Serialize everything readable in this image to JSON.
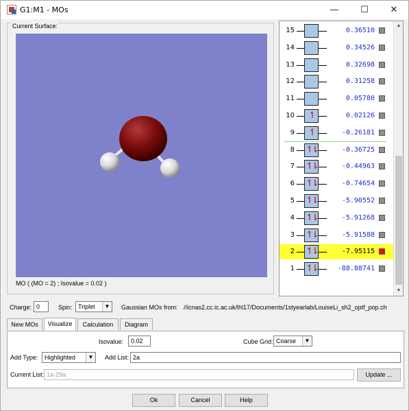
{
  "window": {
    "title": "G1:M1 - MOs"
  },
  "surface": {
    "legend": "Current Surface:",
    "caption": "MO ( (MO = 2) ; Isovalue = 0.02 )"
  },
  "mo_list": [
    {
      "n": "15",
      "energy": "0.36510",
      "occ": "",
      "selected": false,
      "checked": false
    },
    {
      "n": "14",
      "energy": "0.34526",
      "occ": "",
      "selected": false,
      "checked": false
    },
    {
      "n": "13",
      "energy": "0.32698",
      "occ": "",
      "selected": false,
      "checked": false
    },
    {
      "n": "12",
      "energy": "0.31258",
      "occ": "",
      "selected": false,
      "checked": false
    },
    {
      "n": "11",
      "energy": "0.05780",
      "occ": "",
      "selected": false,
      "checked": false
    },
    {
      "n": "10",
      "energy": "0.02126",
      "occ": "↿",
      "selected": false,
      "checked": false
    },
    {
      "n": "9",
      "energy": "-0.26181",
      "occ": "↿",
      "selected": false,
      "checked": false
    },
    {
      "n": "8",
      "energy": "-0.36725",
      "occ": "↿⇂",
      "selected": false,
      "checked": false
    },
    {
      "n": "7",
      "energy": "-0.44963",
      "occ": "↿⇂",
      "selected": false,
      "checked": false
    },
    {
      "n": "6",
      "energy": "-0.74654",
      "occ": "↿⇂",
      "selected": false,
      "checked": false
    },
    {
      "n": "5",
      "energy": "-5.90552",
      "occ": "↿⇂",
      "selected": false,
      "checked": false
    },
    {
      "n": "4",
      "energy": "-5.91268",
      "occ": "↿⇂",
      "selected": false,
      "checked": false
    },
    {
      "n": "3",
      "energy": "-5.91588",
      "occ": "↿⇂",
      "selected": false,
      "checked": false
    },
    {
      "n": "2",
      "energy": "-7.95115",
      "occ": "↿⇂",
      "selected": true,
      "checked": true
    },
    {
      "n": "1",
      "energy": "-88.88741",
      "occ": "↿⇂",
      "selected": false,
      "checked": false
    }
  ],
  "options": {
    "charge_label": "Charge:",
    "charge_value": "0",
    "spin_label": "Spin:",
    "spin_value": "Triplet",
    "source_label": "Gaussian MOs from:",
    "source_path": "//icnas2.cc.ic.ac.uk/lhl17/Documents/1styearlab/LouiseLi_sh2_optf_pop.ch"
  },
  "tabs": [
    "New MOs",
    "Visualize",
    "Calculation",
    "Diagram"
  ],
  "active_tab": "Visualize",
  "visualize": {
    "isovalue_label": "Isovalue:",
    "isovalue_value": "0.02",
    "cube_grid_label": "Cube Grid:",
    "cube_grid_value": "Coarse",
    "add_type_label": "Add Type:",
    "add_type_value": "Highlighted",
    "add_list_label": "Add List:",
    "add_list_value": "2a",
    "current_list_label": "Current List:",
    "current_list_value": "1a-29a",
    "update_label": "Update ..."
  },
  "buttons": {
    "ok": "Ok",
    "cancel": "Cancel",
    "help": "Help"
  },
  "colors": {
    "canvas_bg": "#7f82cb",
    "orbital_box": "#aac8e6",
    "highlight": "#ffff33",
    "energy_text": "#1b2fc9",
    "homo_lumo_line": "#20b020"
  }
}
